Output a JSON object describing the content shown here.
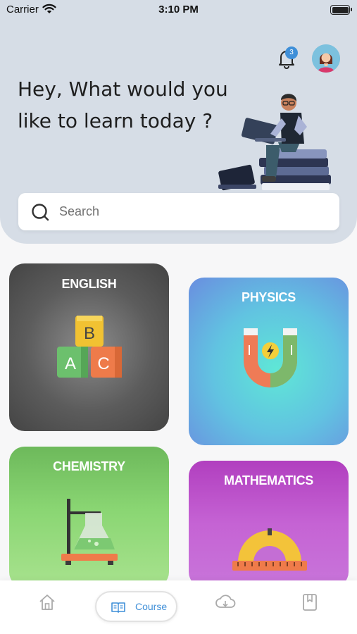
{
  "status_bar": {
    "carrier": "Carrier",
    "time": "3:10 PM"
  },
  "header": {
    "notification_count": "3",
    "greeting": "Hey, What would you like to learn today ?"
  },
  "search": {
    "placeholder": "Search"
  },
  "subjects": [
    {
      "label": "ENGLISH",
      "icon": "abc-blocks-icon"
    },
    {
      "label": "PHYSICS",
      "icon": "magnet-icon"
    },
    {
      "label": "CHEMISTRY",
      "icon": "flask-icon"
    },
    {
      "label": "MATHEMATICS",
      "icon": "protractor-icon"
    }
  ],
  "english_blocks": {
    "top": "B",
    "left": "A",
    "right": "C"
  },
  "tabbar": {
    "items": [
      {
        "icon": "home-icon"
      },
      {
        "icon": "book-icon",
        "label": "Course",
        "active": true
      },
      {
        "icon": "cloud-download-icon"
      },
      {
        "icon": "bookmark-icon"
      }
    ]
  },
  "colors": {
    "accent": "#3f8fd8",
    "hero_bg": "#d6dde6"
  }
}
